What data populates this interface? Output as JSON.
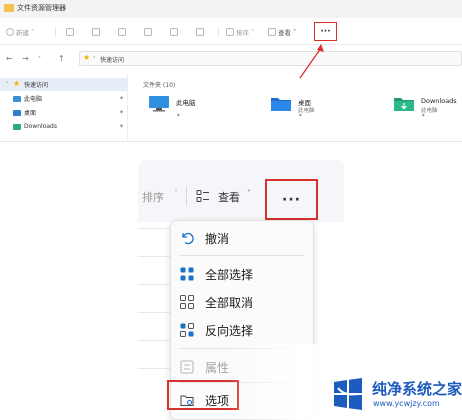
{
  "window": {
    "title": "文件资源管理器"
  },
  "toolbar": {
    "new_label": "新建",
    "sort_label": "排序",
    "view_label": "查看",
    "more_label": "···"
  },
  "address": {
    "path": "快速访问"
  },
  "sidebar": {
    "items": [
      {
        "label": "快速访问",
        "icon": "star-icon",
        "pinned": false
      },
      {
        "label": "此电脑",
        "icon": "monitor-icon",
        "pinned": true
      },
      {
        "label": "桌面",
        "icon": "desktop-icon",
        "pinned": true
      },
      {
        "label": "Downloads",
        "icon": "download-icon",
        "pinned": true
      }
    ]
  },
  "content": {
    "section_title": "文件夹 (10)",
    "folders": [
      {
        "name": "此电脑",
        "sub": "",
        "icon": "monitor-icon"
      },
      {
        "name": "桌面",
        "sub": "此电脑",
        "icon": "desktop-folder-icon"
      },
      {
        "name": "Downloads",
        "sub": "此电脑",
        "icon": "download-folder-icon"
      }
    ]
  },
  "zoomed": {
    "sort_label": "排序",
    "view_label": "查看",
    "more_label": "···"
  },
  "menu": {
    "items": [
      {
        "label": "撤消",
        "icon": "undo-icon",
        "disabled": false
      },
      {
        "label": "全部选择",
        "icon": "select-all-icon",
        "disabled": false
      },
      {
        "label": "全部取消",
        "icon": "select-none-icon",
        "disabled": false
      },
      {
        "label": "反向选择",
        "icon": "invert-selection-icon",
        "disabled": false
      },
      {
        "label": "属性",
        "icon": "properties-icon",
        "disabled": true
      },
      {
        "label": "选项",
        "icon": "options-icon",
        "disabled": false
      }
    ]
  },
  "watermark": {
    "title": "纯净系统之家",
    "url": "www.ycwjzy.com"
  },
  "colors": {
    "highlight": "#d9322c",
    "accent": "#1d5bbf",
    "folder_yellow": "#f2c14e"
  }
}
